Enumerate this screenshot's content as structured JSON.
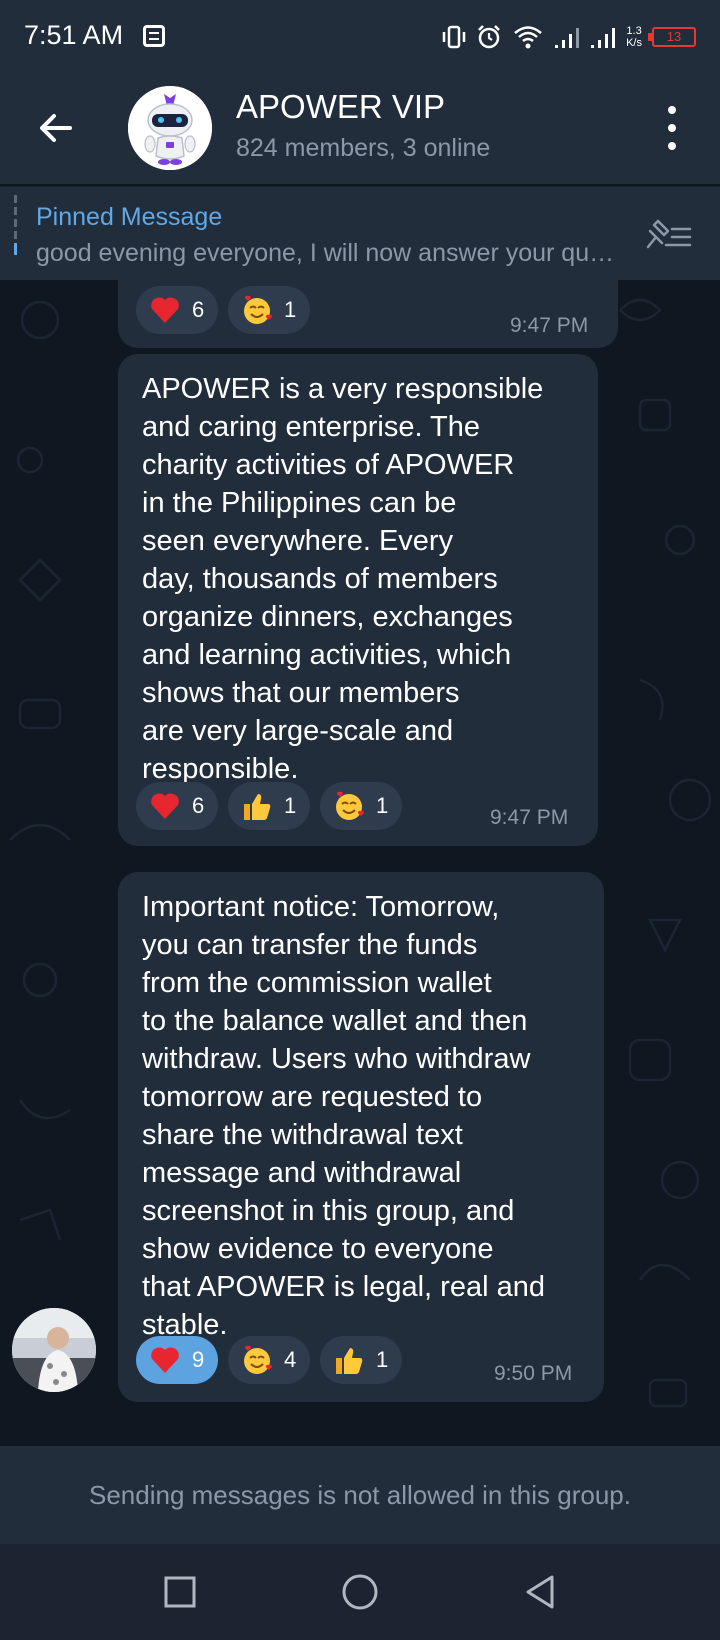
{
  "status_bar": {
    "time": "7:51 AM",
    "speed_value": "1.3",
    "speed_unit": "K/s",
    "battery": "13",
    "icons": [
      "notification-icon",
      "vibrate-icon",
      "alarm-icon",
      "wifi-icon",
      "signal-icon",
      "signal-icon",
      "battery-icon"
    ]
  },
  "header": {
    "title": "APOWER VIP",
    "subtitle": "824 members, 3 online"
  },
  "pinned": {
    "title": "Pinned Message",
    "text": "good evening everyone, I will now answer your questions"
  },
  "messages": [
    {
      "lines": [],
      "reactions": [
        {
          "emoji": "heart-emoji",
          "count": "6",
          "mine": false
        },
        {
          "emoji": "smiling-face-with-hearts-emoji",
          "count": "1",
          "mine": false
        }
      ],
      "time": "9:47 PM"
    },
    {
      "lines": [
        "APOWER is a very responsible",
        "and caring enterprise. The",
        "charity activities of APOWER",
        "in the Philippines can be",
        "seen everywhere. Every",
        "day, thousands of members",
        "organize dinners, exchanges",
        "and learning activities, which",
        "shows that our members",
        "are very large-scale and",
        "responsible."
      ],
      "reactions": [
        {
          "emoji": "heart-emoji",
          "count": "6",
          "mine": false
        },
        {
          "emoji": "thumbs-up-emoji",
          "count": "1",
          "mine": false
        },
        {
          "emoji": "smiling-face-with-hearts-emoji",
          "count": "1",
          "mine": false
        }
      ],
      "time": "9:47 PM"
    },
    {
      "lines": [
        "Important notice: Tomorrow,",
        "you can transfer the funds",
        "from the commission wallet",
        "to the balance wallet and then",
        "withdraw. Users who withdraw",
        "tomorrow are requested to",
        "share the withdrawal text",
        "message and withdrawal",
        "screenshot in this group, and",
        "show evidence to everyone",
        "that APOWER is legal, real and",
        "stable."
      ],
      "reactions": [
        {
          "emoji": "heart-emoji",
          "count": "9",
          "mine": true
        },
        {
          "emoji": "smiling-face-with-hearts-emoji",
          "count": "4",
          "mine": false
        },
        {
          "emoji": "thumbs-up-emoji",
          "count": "1",
          "mine": false
        }
      ],
      "time": "9:50 PM"
    }
  ],
  "footer": {
    "notice": "Sending messages is not allowed in this group."
  },
  "colors": {
    "background": "#0f1720",
    "bar": "#212d3b",
    "bubble": "#212d3b",
    "accent": "#62a8e5",
    "muted_text": "#8b98a7",
    "my_reaction": "#5da3e0"
  }
}
